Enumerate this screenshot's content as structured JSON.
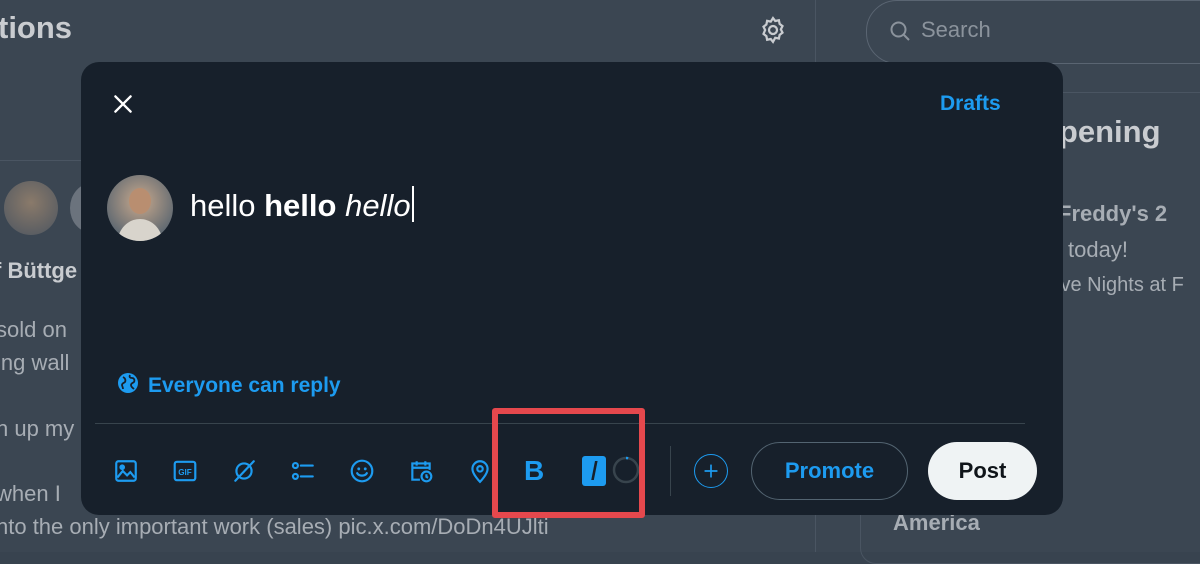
{
  "background": {
    "header_title": "tions",
    "left_texts": [
      "f Büttge",
      "sold on",
      "ing wall",
      "n up my",
      "when I",
      "nto the only important work (sales) pic.x.com/DoDn4UJlti"
    ],
    "search_placeholder": "Search",
    "trend_heading": "ppening",
    "trend_texts": [
      "Freddy's 2",
      "today!",
      "ive Nights at F",
      "America"
    ]
  },
  "compose": {
    "drafts_label": "Drafts",
    "text_plain": "hello ",
    "text_bold": "hello",
    "text_space": " ",
    "text_italic": "hello",
    "reply_label": "Everyone can reply",
    "bold_label": "B",
    "italic_label": "I",
    "promote_label": "Promote",
    "post_label": "Post"
  },
  "icons": {
    "close": "close-icon",
    "gear": "gear-icon",
    "search": "search-icon",
    "globe": "globe-icon",
    "media": "image-icon",
    "gif": "gif-icon",
    "grok": "grok-icon",
    "poll": "poll-icon",
    "emoji": "emoji-icon",
    "schedule": "schedule-icon",
    "location": "location-icon",
    "plus": "plus-icon"
  },
  "colors": {
    "accent": "#1d9bf0",
    "modal_bg": "#17202b",
    "highlight": "#e5484d"
  }
}
